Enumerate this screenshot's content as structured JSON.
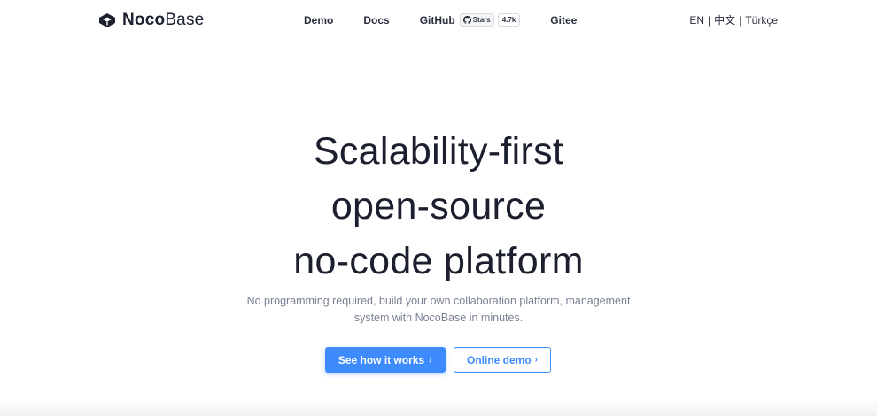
{
  "brand": {
    "name_bold": "Noco",
    "name_light": "Base",
    "logo_icon": "nocobase-cube-icon"
  },
  "nav": {
    "demo": "Demo",
    "docs": "Docs",
    "github": "GitHub",
    "stars_label": "Stars",
    "stars_count": "4.7k",
    "gitee": "Gitee"
  },
  "languages": {
    "en": "EN",
    "zh": "中文",
    "tr": "Türkçe",
    "separator": "|"
  },
  "hero": {
    "title_lines": [
      "Scalability-first",
      "open-source",
      "no-code platform"
    ],
    "subtitle_lines": [
      "No programming required, build your own collaboration platform, management",
      "system with NocoBase in minutes."
    ]
  },
  "cta": {
    "primary_label": "See how it works",
    "primary_icon": "↓",
    "secondary_label": "Online demo",
    "secondary_icon": "›"
  },
  "colors": {
    "accent": "#3d8bfd",
    "text": "#1b1f2e",
    "muted": "#7a8194"
  }
}
